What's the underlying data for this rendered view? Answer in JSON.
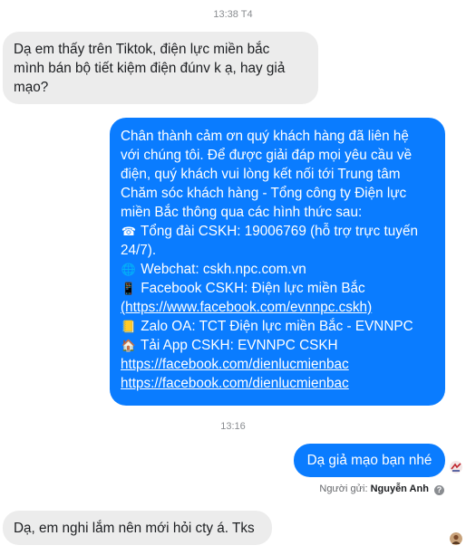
{
  "timestamps": {
    "first": "13:38 T4",
    "second": "13:16"
  },
  "messages": {
    "incoming_1": {
      "lines": [
        "Dạ em thấy trên Tiktok, điện lực miền bắc",
        "mình bán bộ tiết kiệm điện đúnv k ạ, hay giả",
        "mạo?"
      ]
    },
    "outgoing_1": {
      "lines": [
        "Chân thành cảm ơn quý khách hàng đã liên hệ",
        "với chúng tôi. Để được giải đáp mọi yêu cầu về",
        "điện, quý khách vui lòng kết nối tới Trung tâm",
        "Chăm sóc khách hàng - Tổng công ty Điện lực",
        "miền Bắc thông qua các hình thức sau:"
      ],
      "hotline": "Tổng đài CSKH: 19006769 (hỗ trợ trực tuyến",
      "hotline_2": "24/7).",
      "webchat": "Webchat: cskh.npc.com.vn",
      "facebook": "Facebook CSKH: Điện lực miền Bắc",
      "facebook_link": "(https://www.facebook.com/evnnpc.cskh)",
      "zalo": "Zalo OA: TCT Điện lực miền Bắc - EVNNPC",
      "app": "Tải App CSKH: EVNNPC CSKH",
      "link_1": "https://facebook.com/dienlucmienbac",
      "link_2": "https://facebook.com/dienlucmienbac",
      "icons": [
        "telephone-icon",
        "globe-icon",
        "mobile-phone-icon",
        "note-icon",
        "house-icon"
      ]
    },
    "outgoing_2": {
      "text": "Dạ giả mạo bạn nhé"
    },
    "incoming_2": {
      "text": "Dạ, em nghi lắm nên mới hỏi cty á. Tks"
    }
  },
  "sender_info": {
    "label": "Người gửi:",
    "name": "Nguyễn Anh",
    "help": "?"
  },
  "colors": {
    "outgoing": "#0a7cff",
    "incoming": "#ececec",
    "timestamp": "#8a8d91"
  }
}
